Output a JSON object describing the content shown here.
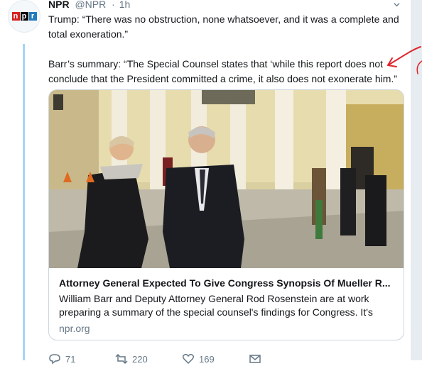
{
  "tweet": {
    "author_name": "NPR",
    "author_handle": "@NPR",
    "separator": "·",
    "time": "1h",
    "paragraphs": [
      "Trump: “There was no obstruction, none whatsoever, and it was a complete and total exoneration.”",
      "Barr’s summary: “The Special Counsel states that ‘while this report does not conclude that the President committed a crime, it also does not exonerate him.”"
    ]
  },
  "avatar": {
    "logo_letters": [
      "n",
      "p",
      "r"
    ]
  },
  "card": {
    "title": "Attorney General Expected To Give Congress Synopsis Of Mueller R...",
    "description": "William Barr and Deputy Attorney General Rod Rosenstein are at work preparing a summary of the special counsel's findings for Congress. It's",
    "domain": "npr.org"
  },
  "actions": {
    "reply_count": "71",
    "retweet_count": "220",
    "like_count": "169"
  },
  "colors": {
    "thread_line": "#a5d4f5",
    "secondary_text": "#657786",
    "annotation_red": "#e0242b"
  }
}
